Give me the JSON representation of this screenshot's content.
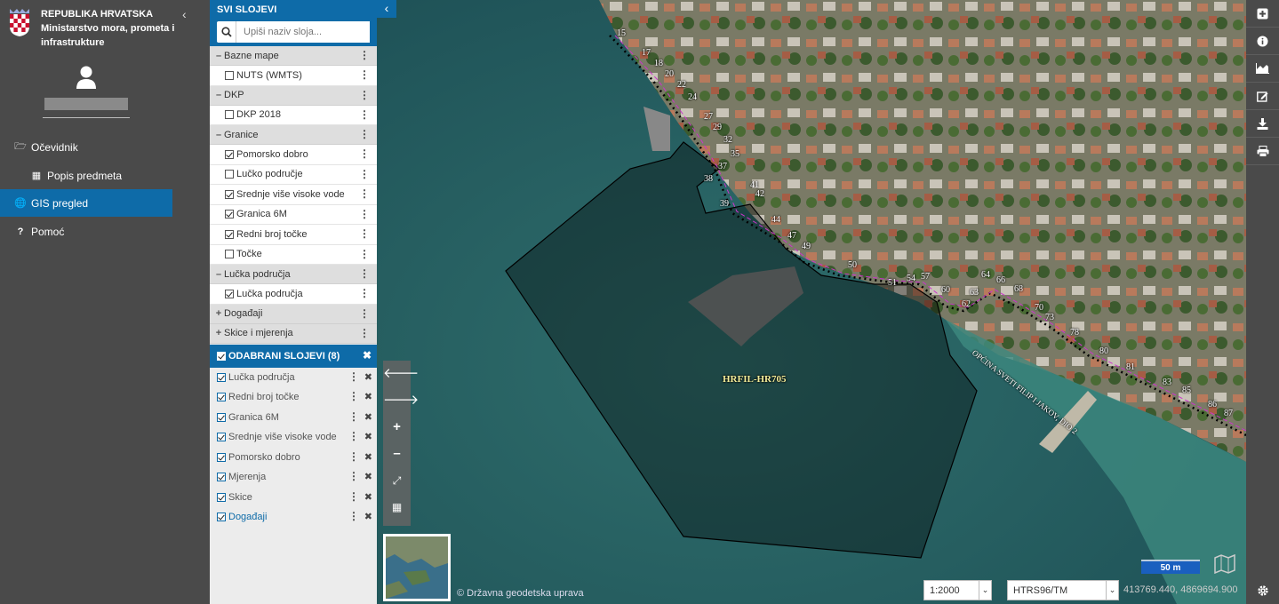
{
  "nav": {
    "org_line1": "REPUBLIKA HRVATSKA",
    "org_line2": "Ministarstvo mora, prometa i infrastrukture",
    "items": [
      {
        "label": "Očevidnik"
      },
      {
        "label": "Popis predmeta"
      },
      {
        "label": "GIS pregled"
      },
      {
        "label": "Pomoć"
      }
    ]
  },
  "layers": {
    "title": "SVI SLOJEVI",
    "search_placeholder": "Upiši naziv sloja...",
    "groups": [
      {
        "label": "Bazne mape",
        "expanded": true,
        "items": [
          {
            "label": "NUTS (WMTS)",
            "checked": false
          }
        ]
      },
      {
        "label": "DKP",
        "expanded": true,
        "items": [
          {
            "label": "DKP 2018",
            "checked": false
          }
        ]
      },
      {
        "label": "Granice",
        "expanded": true,
        "items": [
          {
            "label": "Pomorsko dobro",
            "checked": true
          },
          {
            "label": "Lučko područje",
            "checked": false
          },
          {
            "label": "Srednje više visoke vode",
            "checked": true
          },
          {
            "label": "Granica 6M",
            "checked": true
          },
          {
            "label": "Redni broj točke",
            "checked": true
          },
          {
            "label": "Točke",
            "checked": false
          }
        ]
      },
      {
        "label": "Lučka područja",
        "expanded": true,
        "items": [
          {
            "label": "Lučka područja",
            "checked": true
          }
        ]
      },
      {
        "label": "Događaji",
        "expanded": false,
        "items": []
      },
      {
        "label": "Skice i mjerenja",
        "expanded": false,
        "items": []
      }
    ],
    "selected_title": "ODABRANI SLOJEVI (8)",
    "selected": [
      {
        "label": "Lučka područja"
      },
      {
        "label": "Redni broj točke"
      },
      {
        "label": "Granica 6M"
      },
      {
        "label": "Srednje više visoke vode"
      },
      {
        "label": "Pomorsko dobro"
      },
      {
        "label": "Mjerenja"
      },
      {
        "label": "Skice"
      },
      {
        "label": "Događaji"
      }
    ]
  },
  "map": {
    "polygon_label": "HRFIL-HR705",
    "boundary_label": "OPĆINA SVETI FILIP I JAKOV, DIO 2",
    "point_numbers": [
      "15",
      "17",
      "18",
      "20",
      "22",
      "24",
      "27",
      "29",
      "32",
      "35",
      "37",
      "38",
      "39",
      "41",
      "42",
      "44",
      "47",
      "49",
      "50",
      "51",
      "54",
      "57",
      "60",
      "62",
      "63",
      "64",
      "66",
      "68",
      "70",
      "73",
      "78",
      "80",
      "81",
      "83",
      "85",
      "86",
      "87"
    ],
    "attribution": "© Državna geodetska uprava",
    "scale": "1:2000",
    "crs": "HTRS96/TM",
    "coordinates": "413769.440, 4869694.900",
    "scalebar_label": "50 m"
  }
}
